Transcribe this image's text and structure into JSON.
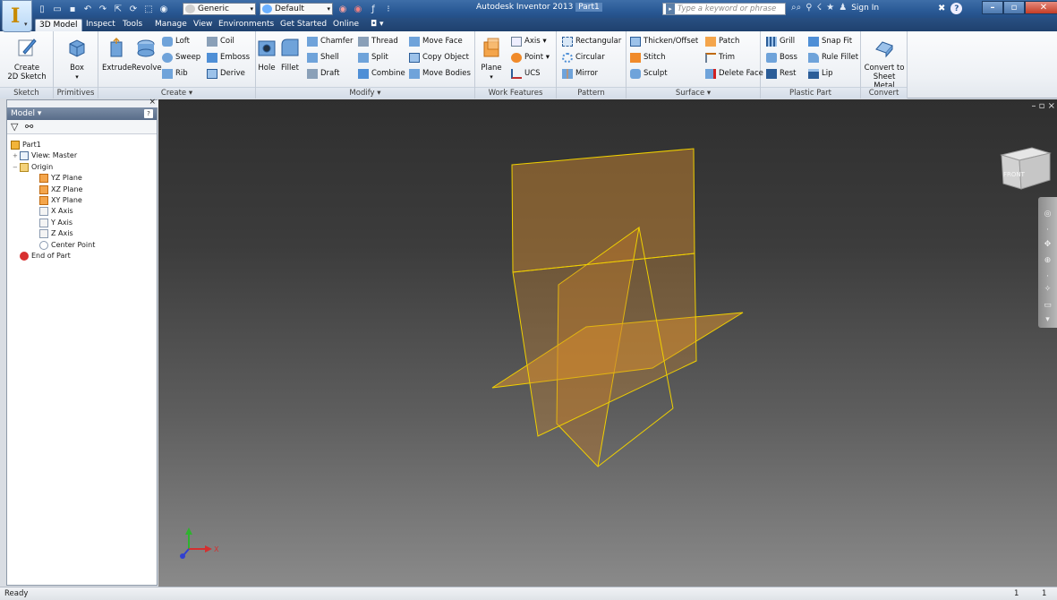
{
  "app": {
    "title": "Autodesk Inventor 2013",
    "document": "Part1",
    "logo_letter": "I"
  },
  "titlebar": {
    "material": "Generic",
    "appearance": "Default",
    "search_placeholder": "Type a keyword or phrase",
    "sign_in": "Sign In"
  },
  "tabs": [
    {
      "label": "3D Model",
      "active": true
    },
    {
      "label": "Inspect",
      "active": false
    },
    {
      "label": "Tools",
      "active": false
    },
    {
      "label": "Manage",
      "active": false
    },
    {
      "label": "View",
      "active": false
    },
    {
      "label": "Environments",
      "active": false
    },
    {
      "label": "Get Started",
      "active": false
    },
    {
      "label": "Online",
      "active": false
    }
  ],
  "ribbon": {
    "sketch": {
      "label": "Sketch",
      "create_2d_sketch": "Create\n2D Sketch"
    },
    "primitives": {
      "label": "Primitives",
      "box": "Box"
    },
    "create": {
      "label": "Create ▾",
      "extrude": "Extrude",
      "revolve": "Revolve",
      "loft": "Loft",
      "sweep": "Sweep",
      "rib": "Rib",
      "coil": "Coil",
      "emboss": "Emboss",
      "derive": "Derive"
    },
    "modify": {
      "label": "Modify ▾",
      "hole": "Hole",
      "fillet": "Fillet",
      "chamfer": "Chamfer",
      "shell": "Shell",
      "draft": "Draft",
      "thread": "Thread",
      "split": "Split",
      "combine": "Combine",
      "move_face": "Move Face",
      "copy_object": "Copy Object",
      "move_bodies": "Move Bodies"
    },
    "work_features": {
      "label": "Work Features",
      "plane": "Plane",
      "axis": "Axis ▾",
      "point": "Point ▾",
      "ucs": "UCS"
    },
    "pattern": {
      "label": "Pattern",
      "rectangular": "Rectangular",
      "circular": "Circular",
      "mirror": "Mirror"
    },
    "surface": {
      "label": "Surface ▾",
      "thicken_offset": "Thicken/Offset",
      "stitch": "Stitch",
      "sculpt": "Sculpt",
      "patch": "Patch",
      "trim": "Trim",
      "delete_face": "Delete Face"
    },
    "plastic_part": {
      "label": "Plastic Part",
      "grill": "Grill",
      "boss": "Boss",
      "rest": "Rest",
      "snap_fit": "Snap Fit",
      "rule_fillet": "Rule Fillet",
      "lip": "Lip"
    },
    "convert": {
      "label": "Convert",
      "convert_to_sheet_metal": "Convert to\nSheet Metal"
    }
  },
  "browser": {
    "title": "Model ▾",
    "tree": [
      {
        "label": "Part1",
        "level": 0,
        "icon": "part-icon"
      },
      {
        "label": "View: Master",
        "level": 1,
        "icon": "view-icon"
      },
      {
        "label": "Origin",
        "level": 1,
        "icon": "folder-icon"
      },
      {
        "label": "YZ Plane",
        "level": 2,
        "icon": "plane-icon"
      },
      {
        "label": "XZ Plane",
        "level": 2,
        "icon": "plane-icon"
      },
      {
        "label": "XY Plane",
        "level": 2,
        "icon": "plane-icon"
      },
      {
        "label": "X Axis",
        "level": 2,
        "icon": "axis-icon"
      },
      {
        "label": "Y Axis",
        "level": 2,
        "icon": "axis-icon"
      },
      {
        "label": "Z Axis",
        "level": 2,
        "icon": "axis-icon"
      },
      {
        "label": "Center Point",
        "level": 2,
        "icon": "point-icon"
      },
      {
        "label": "End of Part",
        "level": 1,
        "icon": "end-of-part-icon"
      }
    ]
  },
  "viewcube": {
    "face": "FRONT"
  },
  "triad": {
    "x_label": "X"
  },
  "status": {
    "text": "Ready",
    "count1": "1",
    "count2": "1"
  },
  "colors": {
    "accent": "#2a5a96",
    "plane_fill": "#c8842d",
    "plane_edge": "#f0d000"
  }
}
